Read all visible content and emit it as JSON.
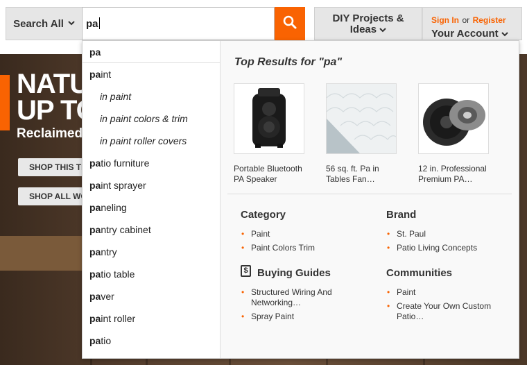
{
  "header": {
    "search_all": "Search All",
    "search_value": "pa",
    "diy_line1": "DIY Projects &",
    "diy_line2": "Ideas",
    "sign_in": "Sign In",
    "or": "or",
    "register": "Register",
    "your_account": "Your Account"
  },
  "hero": {
    "headline_1": "NATU",
    "headline_2": "UP TO",
    "subline": "Reclaimed",
    "btn1": "SHOP THIS TI",
    "btn2": "SHOP ALL WO"
  },
  "suggestions": {
    "first": "pa",
    "items": [
      {
        "bold": "pa",
        "rest": "int",
        "sub": false
      },
      {
        "bold": "",
        "rest": "in paint",
        "sub": true
      },
      {
        "bold": "",
        "rest": "in paint colors & trim",
        "sub": true
      },
      {
        "bold": "",
        "rest": "in paint roller covers",
        "sub": true
      },
      {
        "bold": "pa",
        "rest": "tio furniture",
        "sub": false
      },
      {
        "bold": "pa",
        "rest": "int sprayer",
        "sub": false
      },
      {
        "bold": "pa",
        "rest": "neling",
        "sub": false
      },
      {
        "bold": "pa",
        "rest": "ntry cabinet",
        "sub": false
      },
      {
        "bold": "pa",
        "rest": "ntry",
        "sub": false
      },
      {
        "bold": "pa",
        "rest": "tio table",
        "sub": false
      },
      {
        "bold": "pa",
        "rest": "ver",
        "sub": false
      },
      {
        "bold": "pa",
        "rest": "int roller",
        "sub": false
      },
      {
        "bold": "pa",
        "rest": "tio",
        "sub": false
      }
    ]
  },
  "results": {
    "title_prefix": "Top Results for ",
    "title_query": "\"pa\"",
    "products": [
      {
        "line1": "Portable Bluetooth",
        "line2": "PA Speaker"
      },
      {
        "line1": "56 sq. ft. Pa in",
        "line2": "Tables Fan…"
      },
      {
        "line1": "12 in. Professional",
        "line2": "Premium PA…"
      }
    ],
    "category_heading": "Category",
    "category": [
      "Paint",
      "Paint Colors Trim"
    ],
    "brand_heading": "Brand",
    "brand": [
      "St. Paul",
      "Patio Living Concepts"
    ],
    "guides_heading": "Buying Guides",
    "guides": [
      {
        "line1": "Structured Wiring And",
        "line2": "Networking…"
      },
      {
        "line1": "Spray Paint",
        "line2": ""
      }
    ],
    "communities_heading": "Communities",
    "communities": [
      {
        "line1": "Paint",
        "line2": ""
      },
      {
        "line1": "Create Your Own Custom",
        "line2": "Patio…"
      }
    ],
    "dollar_icon_glyph": "$"
  },
  "colors": {
    "accent": "#f96302"
  }
}
